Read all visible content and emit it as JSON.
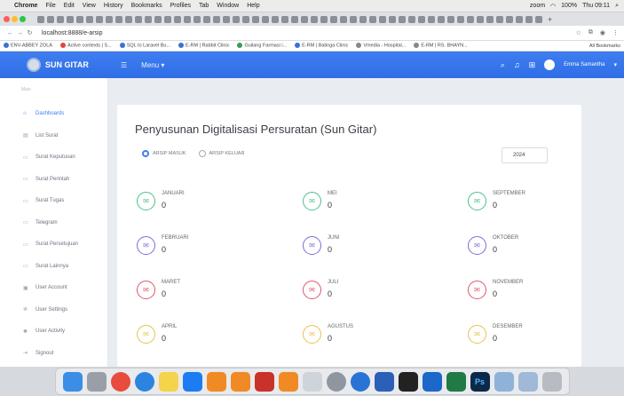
{
  "mac_menubar": {
    "app": "Chrome",
    "items": [
      "File",
      "Edit",
      "View",
      "History",
      "Bookmarks",
      "Profiles",
      "Tab",
      "Window",
      "Help"
    ],
    "zoom": "zoom",
    "battery": "100%",
    "clock": "Thu 09:11"
  },
  "browser": {
    "url": "localhost:8888/e-arsip",
    "bookmarks": [
      "ENV-ABBEY ZOLA",
      "Active contexts | S...",
      "SQL to Laravel Bu...",
      "E-RM | Rabbit Clinic",
      "Guilang Farmasi i...",
      "E-RM | Batinga Clinic",
      "Vmedia - Hospital...",
      "E-RM | RS. BHAYN..."
    ],
    "all_bookmarks": "All Bookmarks"
  },
  "app": {
    "brand": "SUN GITAR",
    "menu_label": "Menu",
    "user_name": "Emma Samantha",
    "colors": {
      "primary": "#3f7df0",
      "sidebar_bg": "#ffffff",
      "page_bg": "#e9edf2"
    }
  },
  "sidebar": {
    "heading": "Main",
    "items": [
      {
        "label": "Dashboards",
        "icon": "home-icon",
        "active": true
      },
      {
        "label": "List Surat",
        "icon": "list-icon"
      },
      {
        "label": "Surat Keputusan",
        "icon": "document-icon"
      },
      {
        "label": "Surat Perintah",
        "icon": "document-icon"
      },
      {
        "label": "Surat Tugas",
        "icon": "document-icon"
      },
      {
        "label": "Telegram",
        "icon": "document-icon"
      },
      {
        "label": "Surat Persetujuan",
        "icon": "document-icon"
      },
      {
        "label": "Surat Lainnya",
        "icon": "document-icon"
      },
      {
        "label": "User Account",
        "icon": "user-icon"
      },
      {
        "label": "User Settings",
        "icon": "gear-icon"
      },
      {
        "label": "User Activity",
        "icon": "activity-icon"
      },
      {
        "label": "Signout",
        "icon": "signout-icon"
      }
    ]
  },
  "main": {
    "title": "Penyusunan Digitalisasi Persuratan (Sun Gitar)",
    "radio_options": [
      {
        "label": "ARSIP MASUK",
        "selected": true
      },
      {
        "label": "ARSIP KELUAR",
        "selected": false
      }
    ],
    "year": "2024",
    "months": [
      {
        "name": "JANUARI",
        "value": "0",
        "color": "#4cc18a"
      },
      {
        "name": "FEBRUARI",
        "value": "0",
        "color": "#7d6bd6"
      },
      {
        "name": "MARET",
        "value": "0",
        "color": "#e0556a"
      },
      {
        "name": "APRIL",
        "value": "0",
        "color": "#e8c24b"
      },
      {
        "name": "MEI",
        "value": "0",
        "color": "#4cc18a"
      },
      {
        "name": "JUNI",
        "value": "0",
        "color": "#7d6bd6"
      },
      {
        "name": "JULI",
        "value": "0",
        "color": "#e0556a"
      },
      {
        "name": "AGUSTUS",
        "value": "0",
        "color": "#e8c24b"
      },
      {
        "name": "SEPTEMBER",
        "value": "0",
        "color": "#4cc18a"
      },
      {
        "name": "OKTOBER",
        "value": "0",
        "color": "#7d6bd6"
      },
      {
        "name": "NOVEMBER",
        "value": "0",
        "color": "#e0556a"
      },
      {
        "name": "DESEMBER",
        "value": "0",
        "color": "#e8c24b"
      }
    ]
  },
  "dock": {
    "apps": [
      "finder-icon",
      "launchpad-icon",
      "chrome-icon",
      "safari-icon",
      "notes-icon",
      "app-store-icon",
      "books-icon",
      "sublime-icon",
      "filezilla-icon",
      "vlc-icon",
      "preview-icon",
      "settings-icon",
      "vscode-icon",
      "word-icon",
      "terminal-icon",
      "outlook-icon",
      "excel-icon",
      "photoshop-icon",
      "downloads-icon",
      "screenshots-icon",
      "trash-icon"
    ],
    "ps_label": "Ps"
  }
}
